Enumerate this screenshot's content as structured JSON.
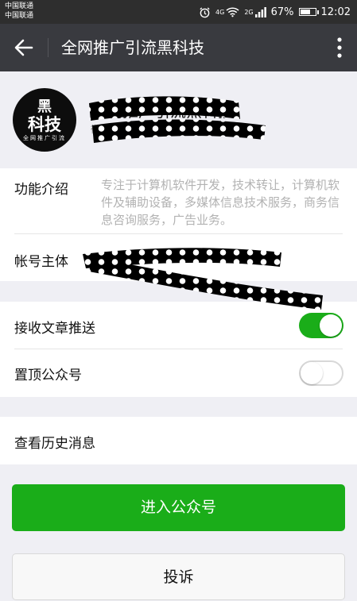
{
  "status_bar": {
    "carrier_1": "中国联通",
    "carrier_2": "中国联通",
    "net_1": "4G",
    "net_2": "2G",
    "battery": "67%",
    "battery_level": 0.67,
    "time": "12:02"
  },
  "header": {
    "title": "全网推广引流黑科技"
  },
  "profile": {
    "avatar_top": "黑",
    "avatar_mid": "科技",
    "avatar_sub": "全网推广引流",
    "name": "全网推广引流黑科技",
    "account_id": "微信号：..."
  },
  "info": {
    "intro_label": "功能介绍",
    "intro_text": "专注于计算机软件开发，技术转让，计算机软件及辅助设备，多媒体信息技术服务，商务信息咨询服务，广告业务。",
    "subject_label": "帐号主体",
    "subject_value": "郑州..."
  },
  "settings": {
    "push_label": "接收文章推送",
    "push_on": true,
    "top_label": "置顶公众号",
    "top_on": false
  },
  "history": {
    "label": "查看历史消息"
  },
  "actions": {
    "enter_label": "进入公众号",
    "report_label": "投诉"
  },
  "colors": {
    "wechat_green": "#1aad19",
    "titlebar": "#393a3f",
    "background": "#efeff4"
  }
}
